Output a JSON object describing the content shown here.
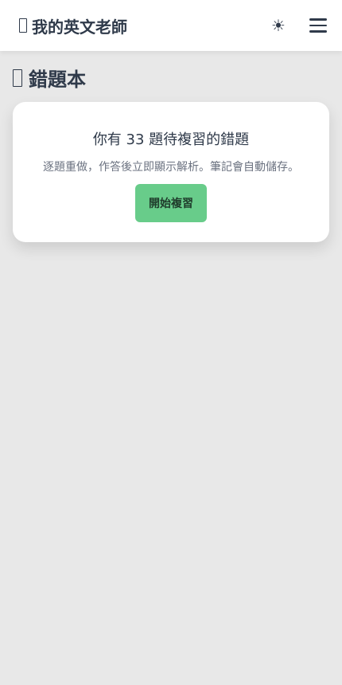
{
  "header": {
    "app_title": "我的英文老師",
    "title_icon": "missing-glyph-icon",
    "theme_toggle_glyph": "☀",
    "theme_toggle_icon": "sun-icon",
    "menu_icon": "hamburger-menu-icon"
  },
  "page": {
    "title": "錯題本",
    "title_icon": "missing-glyph-icon"
  },
  "review_card": {
    "heading": "你有 33 題待複習的錯題",
    "pending_count": 33,
    "description": "逐題重做，作答後立即顯示解析。筆記會自動儲存。",
    "start_button_label": "開始複習"
  },
  "colors": {
    "background": "#e8e8e8",
    "header_background": "#ffffff",
    "card_background": "#ffffff",
    "primary_button": "#68cc8a",
    "text_primary": "#2f3a4a",
    "text_secondary": "#6b7280"
  }
}
